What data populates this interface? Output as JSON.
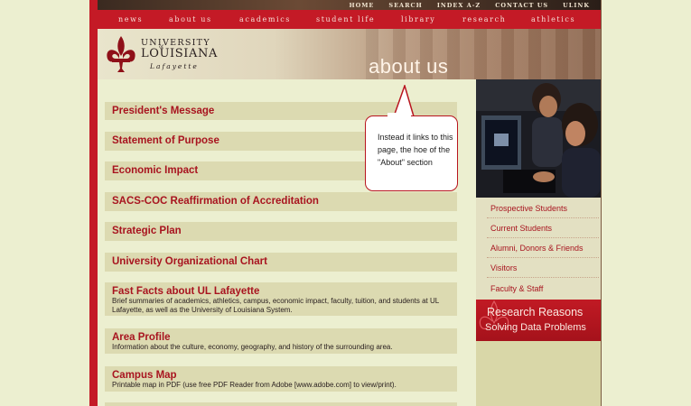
{
  "utility_nav": [
    "HOME",
    "SEARCH",
    "INDEX A-Z",
    "CONTACT US",
    "ULINK"
  ],
  "main_nav": [
    "news",
    "about us",
    "academics",
    "student life",
    "library",
    "research",
    "athletics"
  ],
  "logo": {
    "university": "UNIVERSITY",
    "of": "of",
    "louisiana": "LOUISIANA",
    "lafayette": "Lafayette"
  },
  "page_heading": "about us",
  "menu": [
    {
      "title": "President's Message",
      "desc": ""
    },
    {
      "title": "Statement of Purpose",
      "desc": ""
    },
    {
      "title": "Economic Impact",
      "desc": ""
    },
    {
      "title": "SACS-COC Reaffirmation of Accreditation",
      "desc": ""
    },
    {
      "title": "Strategic Plan",
      "desc": ""
    },
    {
      "title": "University Organizational Chart",
      "desc": ""
    },
    {
      "title": "Fast Facts about UL Lafayette",
      "desc": "Brief summaries of academics, athletics, campus, economic impact, faculty, tuition, and students at UL Lafayette, as well as the University of Louisiana System."
    },
    {
      "title": "Area Profile",
      "desc": "Information about the culture, economy, geography, and history of the surrounding area."
    },
    {
      "title": "Campus Map",
      "desc": "Printable map in PDF (use free PDF Reader from Adobe [www.adobe.com] to view/print)."
    }
  ],
  "callout": {
    "text": "Instead it links to this page, the hoe of the \"About\" section"
  },
  "sidebar": {
    "links": [
      "Prospective Students",
      "Current Students",
      "Alumni, Donors & Friends",
      "Visitors",
      "Faculty & Staff"
    ],
    "feature": {
      "line1": "Research Reasons",
      "line2": "Solving Data Problems"
    }
  },
  "colors": {
    "accent": "#c41a26",
    "background": "#ecefd0",
    "bar": "#dcdab1"
  }
}
